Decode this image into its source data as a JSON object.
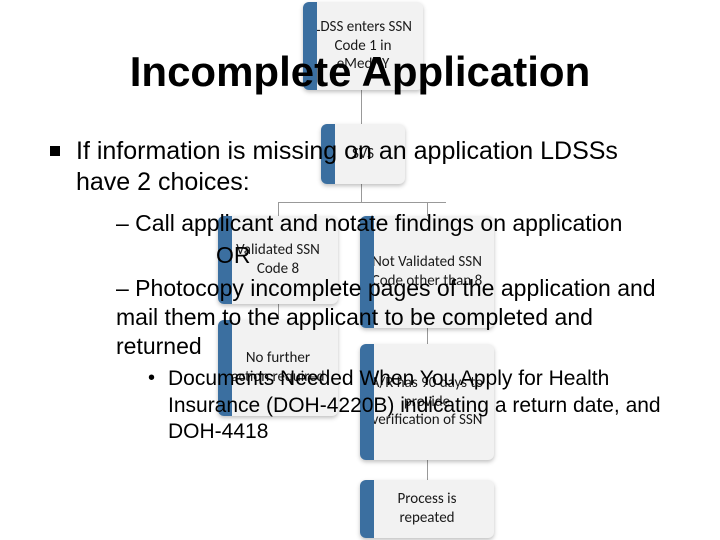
{
  "title": "Incomplete Application",
  "bullet1": "If information is missing on an application LDSSs have 2 choices:",
  "choice1": "– Call applicant and notate findings on application",
  "or": "OR",
  "choice2": "– Photocopy incomplete pages of the application and mail them to the applicant to be completed and returned",
  "sub1": "Documents Needed When You Apply for Health Insurance (DOH-4220B) indicating a return date, and DOH-4418",
  "flow": {
    "top": "LDSS enters SSN Code 1 in eMedNY",
    "svs": "SVS",
    "validated": "Validated SSN Code 8",
    "notvalidated": "Not Validated SSN Code other than 8",
    "leftaction": "No further action required",
    "rightaction": "A/R has 90 days to provide verification of SSN",
    "repeat": "Process is repeated"
  }
}
